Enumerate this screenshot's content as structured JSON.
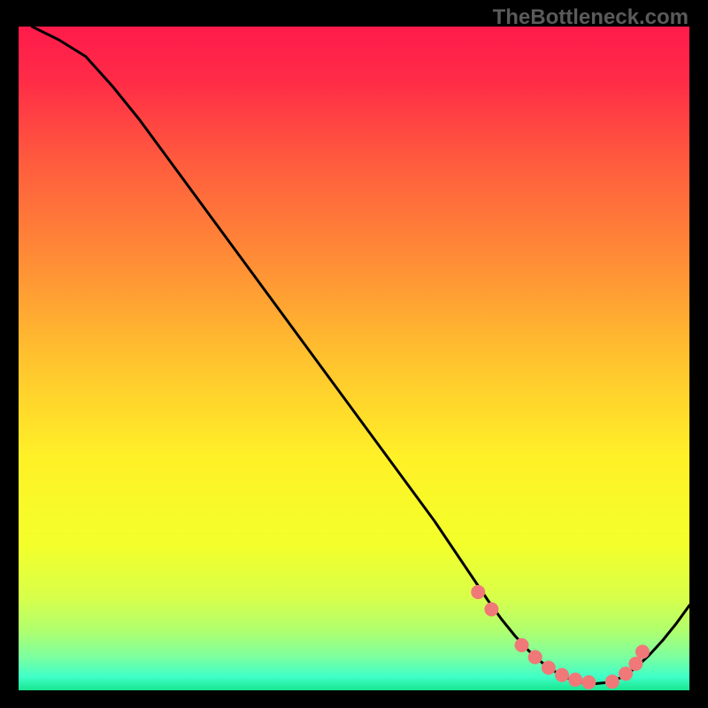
{
  "watermark": "TheBottleneck.com",
  "chart_data": {
    "type": "line",
    "title": "",
    "xlabel": "",
    "ylabel": "",
    "xlim": [
      0,
      100
    ],
    "ylim": [
      0,
      100
    ],
    "background_gradient": {
      "stops": [
        {
          "offset": 0.0,
          "color": "#ff1b4b"
        },
        {
          "offset": 0.08,
          "color": "#ff2b47"
        },
        {
          "offset": 0.2,
          "color": "#ff5a3e"
        },
        {
          "offset": 0.35,
          "color": "#ff8c36"
        },
        {
          "offset": 0.5,
          "color": "#ffc22e"
        },
        {
          "offset": 0.65,
          "color": "#fff127"
        },
        {
          "offset": 0.78,
          "color": "#f3ff2a"
        },
        {
          "offset": 0.86,
          "color": "#d8ff4a"
        },
        {
          "offset": 0.91,
          "color": "#b0ff6e"
        },
        {
          "offset": 0.95,
          "color": "#7cffa0"
        },
        {
          "offset": 0.98,
          "color": "#3fffc8"
        },
        {
          "offset": 1.0,
          "color": "#18e58e"
        }
      ]
    },
    "series": [
      {
        "name": "bottleneck-curve",
        "type": "line",
        "color": "#000000",
        "x": [
          2,
          6,
          10,
          14,
          18,
          22,
          26,
          30,
          34,
          38,
          42,
          46,
          50,
          54,
          58,
          62,
          64,
          66,
          68,
          70,
          72,
          74,
          76,
          78,
          80,
          82,
          84,
          86,
          88,
          90,
          92,
          94,
          96,
          98,
          100
        ],
        "y": [
          100,
          98,
          95.5,
          91,
          86,
          80.5,
          75,
          69.5,
          64,
          58.5,
          53,
          47.5,
          42,
          36.5,
          31,
          25.5,
          22.5,
          19.5,
          16.5,
          13.5,
          10.7,
          8.2,
          6.0,
          4.2,
          2.8,
          1.8,
          1.2,
          1.0,
          1.2,
          2.0,
          3.4,
          5.3,
          7.5,
          10.0,
          12.8
        ]
      },
      {
        "name": "optimal-points",
        "type": "scatter",
        "color": "#f07878",
        "x": [
          68.5,
          70.5,
          75.0,
          77.0,
          79.0,
          81.0,
          83.0,
          85.0,
          88.5,
          90.5,
          92.0,
          93.0
        ],
        "y": [
          14.8,
          12.2,
          6.8,
          5.0,
          3.4,
          2.3,
          1.6,
          1.2,
          1.3,
          2.5,
          4.0,
          5.8
        ]
      }
    ]
  }
}
